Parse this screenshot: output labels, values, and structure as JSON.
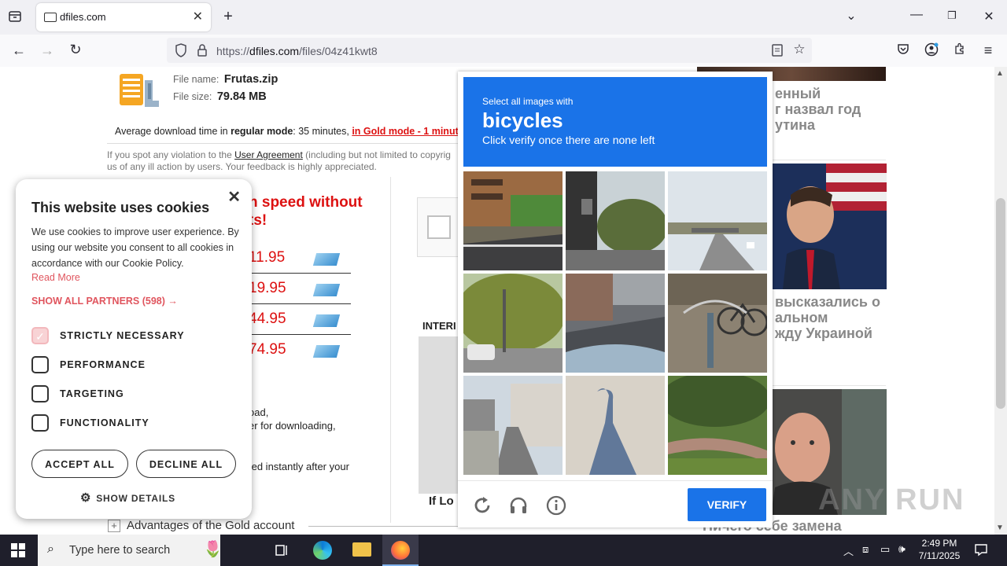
{
  "browser": {
    "tab_title": "dfiles.com",
    "url_prefix": "https://",
    "url_domain": "dfiles.com",
    "url_path": "/files/04z41kwt8"
  },
  "file": {
    "name_label": "File name:",
    "name": "Frutas.zip",
    "size_label": "File size:",
    "size": "79.84 MB"
  },
  "download_time": {
    "prefix": "Average download time in ",
    "regular_mode": "regular mode",
    "middle": ": 35 minutes, ",
    "gold_link": "in Gold mode - 1 minut"
  },
  "violation": {
    "line1_a": "If you spot any violation to the ",
    "agreement_link": "User Agreement",
    "line1_b": " (including but not limited to copyrig",
    "line2": "us of any ill action by users. Your feedback is highly appreciated."
  },
  "promo": {
    "headline_1": "n speed without",
    "headline_2": "ts!",
    "prices": [
      "11.95",
      "19.95",
      "44.95",
      "74.95"
    ],
    "text_1": ",",
    "text_2": "oad,",
    "text_3": "er for downloading,",
    "text_4": "ted instantly after your",
    "inter_label": "INTERI",
    "if_label": "If Lo",
    "advantages": "Advantages of the Gold account"
  },
  "news": {
    "item1": [
      "енный",
      "г назвал год",
      "утина"
    ],
    "item2": [
      "высказались о",
      "альном",
      "жду Украиной"
    ],
    "item3": "Ничего себе замена"
  },
  "cookie": {
    "title": "This website uses cookies",
    "body": "We use cookies to improve user experience. By using our website you consent to all cookies in accordance with our Cookie Policy.",
    "read_more": "Read More",
    "show_partners": "SHOW ALL PARTNERS (598) →",
    "options": [
      "STRICTLY NECESSARY",
      "PERFORMANCE",
      "TARGETING",
      "FUNCTIONALITY"
    ],
    "accept": "ACCEPT ALL",
    "decline": "DECLINE ALL",
    "details": "SHOW DETAILS"
  },
  "captcha": {
    "instruction": "Select all images with",
    "keyword": "bicycles",
    "hint": "Click verify once there are none left",
    "verify": "VERIFY"
  },
  "taskbar": {
    "search_placeholder": "Type here to search",
    "time": "2:49 PM",
    "date": "7/11/2025"
  },
  "watermark": "ANY RUN",
  "colors": {
    "captcha_blue": "#1a73e8",
    "gold_red": "#dd1111",
    "cookie_link": "#e0555e"
  }
}
